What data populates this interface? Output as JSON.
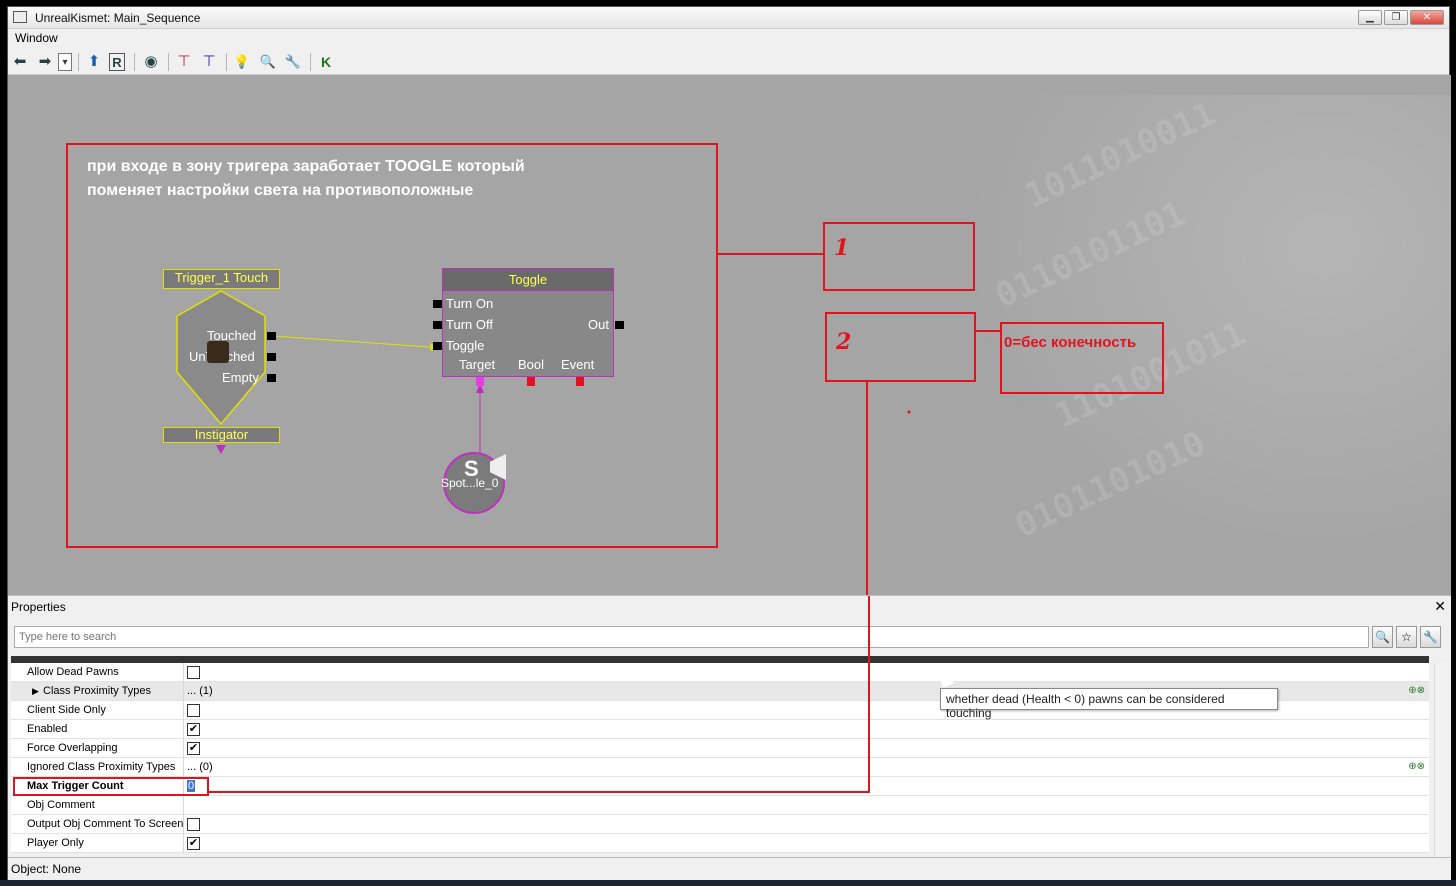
{
  "window": {
    "title": "UnrealKismet: Main_Sequence",
    "minimize": "▁",
    "maximize": "❐",
    "close": "✕"
  },
  "menu": {
    "window_label": "Window"
  },
  "toolbar": {
    "back_icon": "⬅",
    "forward_icon": "➡",
    "dropdown_icon": "▾",
    "up_icon": "⬆",
    "r_icon": "R",
    "eye_icon": "◉",
    "tree1_icon": "⊤",
    "tree2_icon": "⊤",
    "bulb_icon": "💡",
    "zoom_icon": "🔍",
    "wrench_icon": "🔧",
    "k_icon": "K"
  },
  "canvas": {
    "comment_line1": "при входе в зону тригера  заработает TOOGLE  который",
    "comment_line2": "поменяет настройки  света на противоположные",
    "annotation_1": "1",
    "annotation_2": "2",
    "annotation_note": "0=бес конечность",
    "trigger_node": {
      "title": "Trigger_1 Touch",
      "outputs": [
        "Touched",
        "UnTouched",
        "Empty"
      ],
      "footer": "Instigator"
    },
    "toggle_node": {
      "title": "Toggle",
      "inputs": [
        "Turn On",
        "Turn Off",
        "Toggle"
      ],
      "output": "Out",
      "vars": [
        "Target",
        "Bool",
        "Event"
      ]
    },
    "light_label": "Spot...le_0",
    "light_letter": "S"
  },
  "properties": {
    "title": "Properties",
    "close": "✕",
    "search_placeholder": "Type here to search",
    "search_btn": "🔍",
    "star_btn": "☆",
    "wrench_btn": "🔧",
    "rows": [
      {
        "name": "Allow Dead Pawns",
        "type": "check",
        "checked": false
      },
      {
        "name": "Class Proximity Types",
        "type": "text",
        "value": "... (1)"
      },
      {
        "name": "Client Side Only",
        "type": "check",
        "checked": false
      },
      {
        "name": "Enabled",
        "type": "check",
        "checked": true
      },
      {
        "name": "Force Overlapping",
        "type": "check",
        "checked": true
      },
      {
        "name": "Ignored Class Proximity Types",
        "type": "text",
        "value": "... (0)"
      },
      {
        "name": "Max Trigger Count",
        "type": "text",
        "value": "0"
      },
      {
        "name": "Obj Comment",
        "type": "text",
        "value": ""
      },
      {
        "name": "Output Obj Comment To Screen",
        "type": "check",
        "checked": false
      },
      {
        "name": "Player Only",
        "type": "check",
        "checked": true
      }
    ],
    "tooltip": "whether dead (Health < 0) pawns can be considered touching"
  },
  "status": {
    "text": "Object: None"
  },
  "colors": {
    "annotation_red": "#e0141e",
    "canvas_gray": "#a5a5a5",
    "node_border_yellow": "#e0e000",
    "link_magenta": "#c030c0"
  }
}
